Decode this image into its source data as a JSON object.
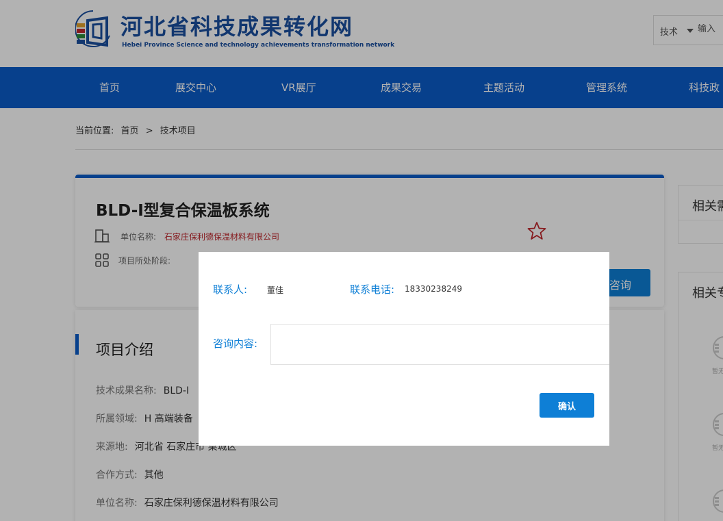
{
  "header": {
    "site_title": "河北省科技成果转化网",
    "site_subtitle": "Hebei Province Science and technology achievements transformation network",
    "search_type": "技术",
    "search_placeholder": "输入"
  },
  "nav": {
    "items": [
      {
        "label": "首页"
      },
      {
        "label": "展交中心"
      },
      {
        "label": "VR展厅"
      },
      {
        "label": "成果交易"
      },
      {
        "label": "主题活动"
      },
      {
        "label": "管理系统"
      },
      {
        "label": "科技政"
      }
    ]
  },
  "breadcrumb": {
    "label": "当前位置:",
    "home": "首页",
    "separator": ">",
    "current": "技术项目"
  },
  "project": {
    "title": "BLD-I型复合保温板系统",
    "company_label": "单位名称:",
    "company_name": "石家庄保利德保温材料有限公司",
    "stage_label": "项目所处阶段:",
    "consult_button": "咨询"
  },
  "intro": {
    "title": "项目介绍",
    "fields": [
      {
        "key": "技术成果名称:",
        "value": "BLD-I"
      },
      {
        "key": "所属领域:",
        "value": "H 高端装备"
      },
      {
        "key": "来源地:",
        "value": "河北省 石家庄市 桌城区"
      },
      {
        "key": "合作方式:",
        "value": "其他"
      },
      {
        "key": "单位名称:",
        "value": "石家庄保利德保温材料有限公司"
      }
    ]
  },
  "sidebar": {
    "card1_title": "相关需",
    "card2_title": "相关专",
    "avatar_label": "暂无"
  },
  "modal": {
    "contact_label": "联系人:",
    "contact_value": "董佳",
    "phone_label": "联系电话:",
    "phone_value": "18330238249",
    "content_label": "咨询内容:",
    "content_value": "",
    "confirm_button": "确认"
  },
  "colors": {
    "brand_blue": "#0b5cc9",
    "accent_blue": "#0e7fd6",
    "link_red": "#c0272d"
  }
}
